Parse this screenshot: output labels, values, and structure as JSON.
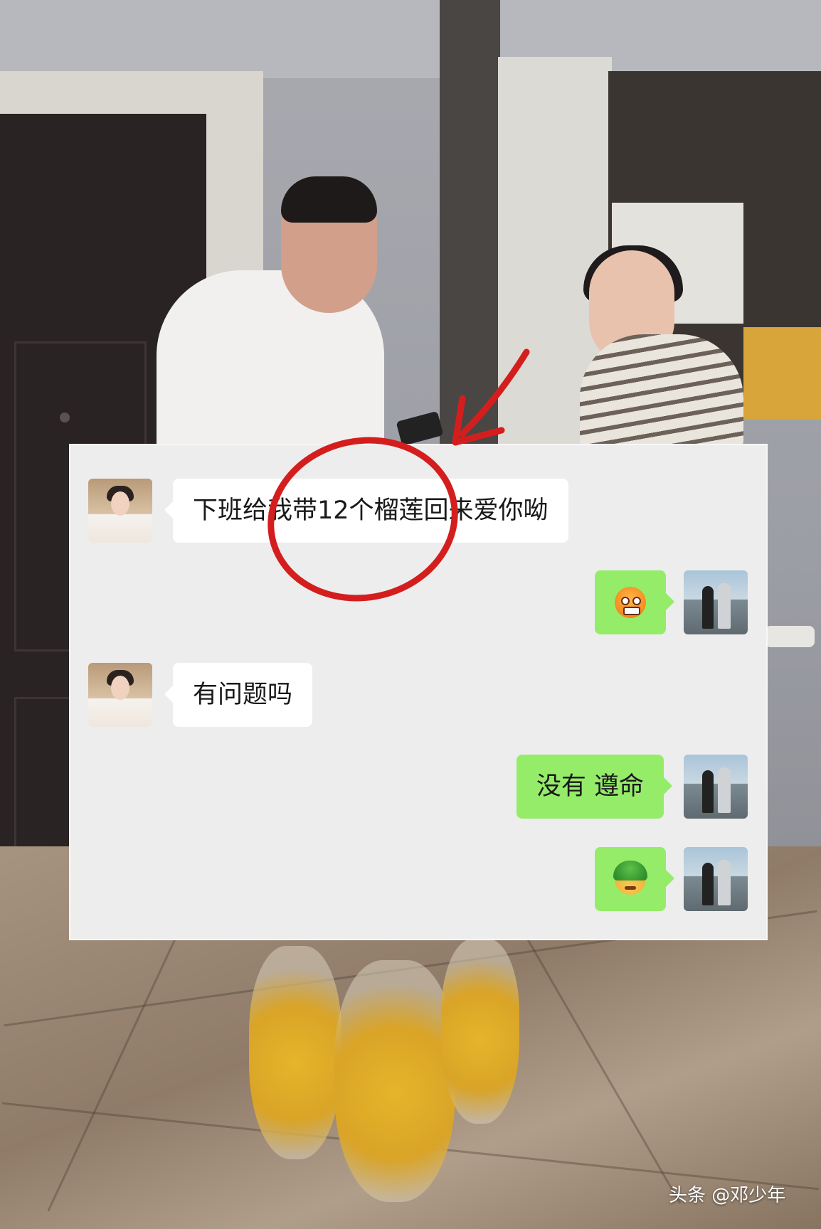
{
  "chat": {
    "messages": [
      {
        "side": "left",
        "sender": "girlfriend",
        "text": "下班给我带12个榴莲回来爱你呦"
      },
      {
        "side": "right",
        "sender": "boyfriend",
        "emoji": "angry-face-emoji"
      },
      {
        "side": "left",
        "sender": "girlfriend",
        "text": "有问题吗"
      },
      {
        "side": "right",
        "sender": "boyfriend",
        "text": "没有 遵命"
      },
      {
        "side": "right",
        "sender": "boyfriend",
        "emoji": "turtle-emoji"
      }
    ]
  },
  "annotation": {
    "color": "#d41e1e",
    "shapes": [
      "circle",
      "arrow"
    ]
  },
  "watermark": {
    "text": "头条 @邓少年"
  },
  "colors": {
    "sent_bubble": "#95ec69",
    "received_bubble": "#ffffff",
    "chat_background": "#ededed"
  }
}
